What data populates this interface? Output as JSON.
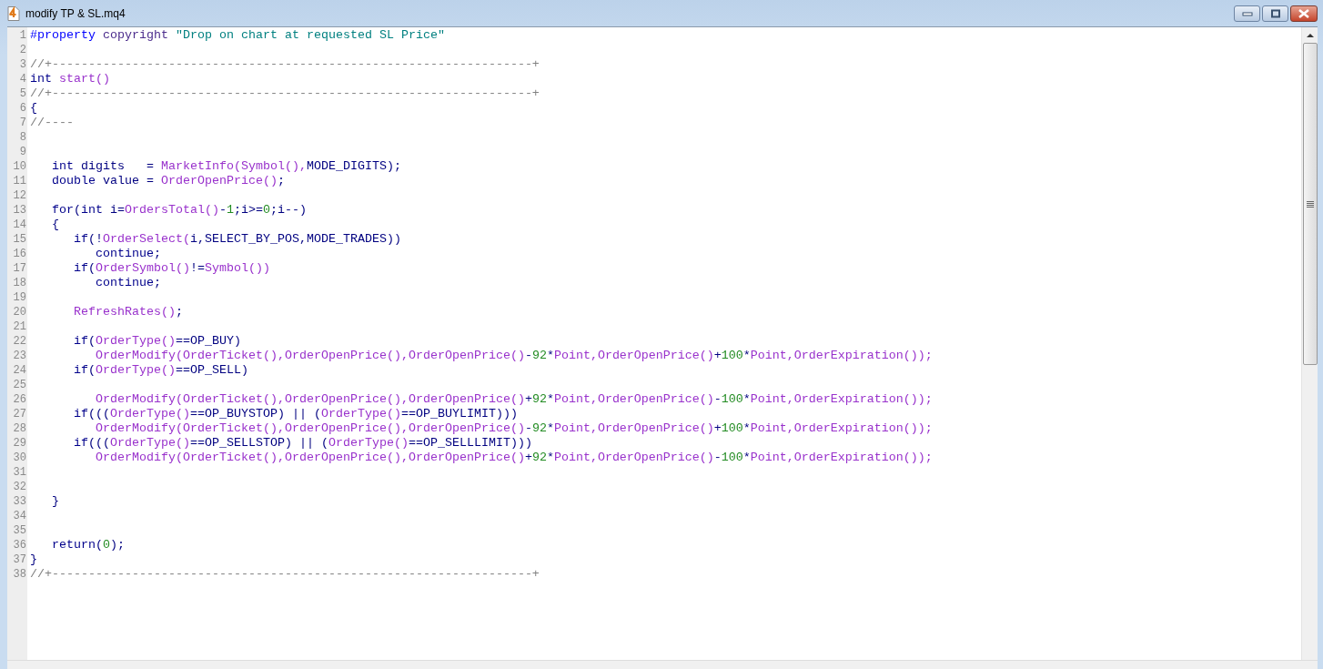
{
  "window": {
    "title": "modify TP & SL.mq4"
  },
  "code_lines": [
    {
      "number": "1",
      "tokens": [
        {
          "kind": "directive",
          "text": "#property "
        },
        {
          "kind": "property",
          "text": "copyright "
        },
        {
          "kind": "string",
          "text": "\"Drop on chart at requested SL Price\""
        }
      ]
    },
    {
      "number": "2"
    },
    {
      "number": "3",
      "tokens": [
        {
          "kind": "comment",
          "text": "//+------------------------------------------------------------------+"
        }
      ]
    },
    {
      "number": "4",
      "tokens": [
        {
          "kind": "keyword",
          "text": "int "
        },
        {
          "kind": "function",
          "text": "start()"
        }
      ]
    },
    {
      "number": "5",
      "tokens": [
        {
          "kind": "comment",
          "text": "//+------------------------------------------------------------------+"
        }
      ]
    },
    {
      "number": "6",
      "tokens": [
        {
          "kind": "plain",
          "text": "{"
        }
      ]
    },
    {
      "number": "7",
      "tokens": [
        {
          "kind": "comment",
          "text": "//----"
        }
      ]
    },
    {
      "number": "8"
    },
    {
      "number": "9"
    },
    {
      "number": "10",
      "tokens": [
        {
          "kind": "keyword",
          "text": "   int"
        },
        {
          "kind": "plain",
          "text": " digits   = "
        },
        {
          "kind": "function",
          "text": "MarketInfo(Symbol(),"
        },
        {
          "kind": "plain",
          "text": "MODE_DIGITS);"
        }
      ]
    },
    {
      "number": "11",
      "tokens": [
        {
          "kind": "keyword",
          "text": "   double"
        },
        {
          "kind": "plain",
          "text": " value = "
        },
        {
          "kind": "function",
          "text": "OrderOpenPrice()"
        },
        {
          "kind": "plain",
          "text": ";"
        }
      ]
    },
    {
      "number": "12"
    },
    {
      "number": "13",
      "tokens": [
        {
          "kind": "keyword",
          "text": "   for"
        },
        {
          "kind": "plain",
          "text": "("
        },
        {
          "kind": "keyword",
          "text": "int"
        },
        {
          "kind": "plain",
          "text": " i="
        },
        {
          "kind": "function",
          "text": "OrdersTotal()"
        },
        {
          "kind": "plain",
          "text": "-"
        },
        {
          "kind": "number",
          "text": "1"
        },
        {
          "kind": "plain",
          "text": ";i>="
        },
        {
          "kind": "number",
          "text": "0"
        },
        {
          "kind": "plain",
          "text": ";i--)"
        }
      ]
    },
    {
      "number": "14",
      "tokens": [
        {
          "kind": "plain",
          "text": "   {"
        }
      ]
    },
    {
      "number": "15",
      "tokens": [
        {
          "kind": "keyword",
          "text": "      if"
        },
        {
          "kind": "plain",
          "text": "(!"
        },
        {
          "kind": "function",
          "text": "OrderSelect("
        },
        {
          "kind": "plain",
          "text": "i,SELECT_BY_POS,MODE_TRADES))"
        }
      ]
    },
    {
      "number": "16",
      "tokens": [
        {
          "kind": "keyword",
          "text": "         continue"
        },
        {
          "kind": "plain",
          "text": ";"
        }
      ]
    },
    {
      "number": "17",
      "tokens": [
        {
          "kind": "keyword",
          "text": "      if"
        },
        {
          "kind": "plain",
          "text": "("
        },
        {
          "kind": "function",
          "text": "OrderSymbol()"
        },
        {
          "kind": "plain",
          "text": "!="
        },
        {
          "kind": "function",
          "text": "Symbol())"
        }
      ]
    },
    {
      "number": "18",
      "tokens": [
        {
          "kind": "keyword",
          "text": "         continue"
        },
        {
          "kind": "plain",
          "text": ";"
        }
      ]
    },
    {
      "number": "19"
    },
    {
      "number": "20",
      "tokens": [
        {
          "kind": "function",
          "text": "      RefreshRates()"
        },
        {
          "kind": "plain",
          "text": ";"
        }
      ]
    },
    {
      "number": "21"
    },
    {
      "number": "22",
      "tokens": [
        {
          "kind": "keyword",
          "text": "      if"
        },
        {
          "kind": "plain",
          "text": "("
        },
        {
          "kind": "function",
          "text": "OrderType()"
        },
        {
          "kind": "plain",
          "text": "==OP_BUY)"
        }
      ]
    },
    {
      "number": "23",
      "tokens": [
        {
          "kind": "function",
          "text": "         OrderModify(OrderTicket(),OrderOpenPrice(),OrderOpenPrice()"
        },
        {
          "kind": "plain",
          "text": "-"
        },
        {
          "kind": "number",
          "text": "92"
        },
        {
          "kind": "plain",
          "text": "*"
        },
        {
          "kind": "function",
          "text": "Point,OrderOpenPrice()"
        },
        {
          "kind": "plain",
          "text": "+"
        },
        {
          "kind": "number",
          "text": "100"
        },
        {
          "kind": "plain",
          "text": "*"
        },
        {
          "kind": "function",
          "text": "Point,OrderExpiration());"
        }
      ]
    },
    {
      "number": "24",
      "tokens": [
        {
          "kind": "keyword",
          "text": "      if"
        },
        {
          "kind": "plain",
          "text": "("
        },
        {
          "kind": "function",
          "text": "OrderType()"
        },
        {
          "kind": "plain",
          "text": "==OP_SELL)"
        }
      ]
    },
    {
      "number": "25"
    },
    {
      "number": "26",
      "tokens": [
        {
          "kind": "function",
          "text": "         OrderModify(OrderTicket(),OrderOpenPrice(),OrderOpenPrice()"
        },
        {
          "kind": "plain",
          "text": "+"
        },
        {
          "kind": "number",
          "text": "92"
        },
        {
          "kind": "plain",
          "text": "*"
        },
        {
          "kind": "function",
          "text": "Point,OrderOpenPrice()"
        },
        {
          "kind": "plain",
          "text": "-"
        },
        {
          "kind": "number",
          "text": "100"
        },
        {
          "kind": "plain",
          "text": "*"
        },
        {
          "kind": "function",
          "text": "Point,OrderExpiration());"
        }
      ]
    },
    {
      "number": "27",
      "tokens": [
        {
          "kind": "keyword",
          "text": "      if"
        },
        {
          "kind": "plain",
          "text": "((("
        },
        {
          "kind": "function",
          "text": "OrderType()"
        },
        {
          "kind": "plain",
          "text": "==OP_BUYSTOP) || ("
        },
        {
          "kind": "function",
          "text": "OrderType()"
        },
        {
          "kind": "plain",
          "text": "==OP_BUYLIMIT)))"
        }
      ]
    },
    {
      "number": "28",
      "tokens": [
        {
          "kind": "function",
          "text": "         OrderModify(OrderTicket(),OrderOpenPrice(),OrderOpenPrice()"
        },
        {
          "kind": "plain",
          "text": "-"
        },
        {
          "kind": "number",
          "text": "92"
        },
        {
          "kind": "plain",
          "text": "*"
        },
        {
          "kind": "function",
          "text": "Point,OrderOpenPrice()"
        },
        {
          "kind": "plain",
          "text": "+"
        },
        {
          "kind": "number",
          "text": "100"
        },
        {
          "kind": "plain",
          "text": "*"
        },
        {
          "kind": "function",
          "text": "Point,OrderExpiration());"
        }
      ]
    },
    {
      "number": "29",
      "tokens": [
        {
          "kind": "keyword",
          "text": "      if"
        },
        {
          "kind": "plain",
          "text": "((("
        },
        {
          "kind": "function",
          "text": "OrderType()"
        },
        {
          "kind": "plain",
          "text": "==OP_SELLSTOP) || ("
        },
        {
          "kind": "function",
          "text": "OrderType()"
        },
        {
          "kind": "plain",
          "text": "==OP_SELLLIMIT)))"
        }
      ]
    },
    {
      "number": "30",
      "tokens": [
        {
          "kind": "function",
          "text": "         OrderModify(OrderTicket(),OrderOpenPrice(),OrderOpenPrice()"
        },
        {
          "kind": "plain",
          "text": "+"
        },
        {
          "kind": "number",
          "text": "92"
        },
        {
          "kind": "plain",
          "text": "*"
        },
        {
          "kind": "function",
          "text": "Point,OrderOpenPrice()"
        },
        {
          "kind": "plain",
          "text": "-"
        },
        {
          "kind": "number",
          "text": "100"
        },
        {
          "kind": "plain",
          "text": "*"
        },
        {
          "kind": "function",
          "text": "Point,OrderExpiration());"
        }
      ]
    },
    {
      "number": "31"
    },
    {
      "number": "32"
    },
    {
      "number": "33",
      "tokens": [
        {
          "kind": "plain",
          "text": "   }"
        }
      ]
    },
    {
      "number": "34"
    },
    {
      "number": "35"
    },
    {
      "number": "36",
      "tokens": [
        {
          "kind": "keyword",
          "text": "   return"
        },
        {
          "kind": "plain",
          "text": "("
        },
        {
          "kind": "number",
          "text": "0"
        },
        {
          "kind": "plain",
          "text": ");"
        }
      ]
    },
    {
      "number": "37",
      "tokens": [
        {
          "kind": "plain",
          "text": "}"
        }
      ]
    },
    {
      "number": "38",
      "tokens": [
        {
          "kind": "comment",
          "text": "//+------------------------------------------------------------------+"
        }
      ]
    }
  ]
}
